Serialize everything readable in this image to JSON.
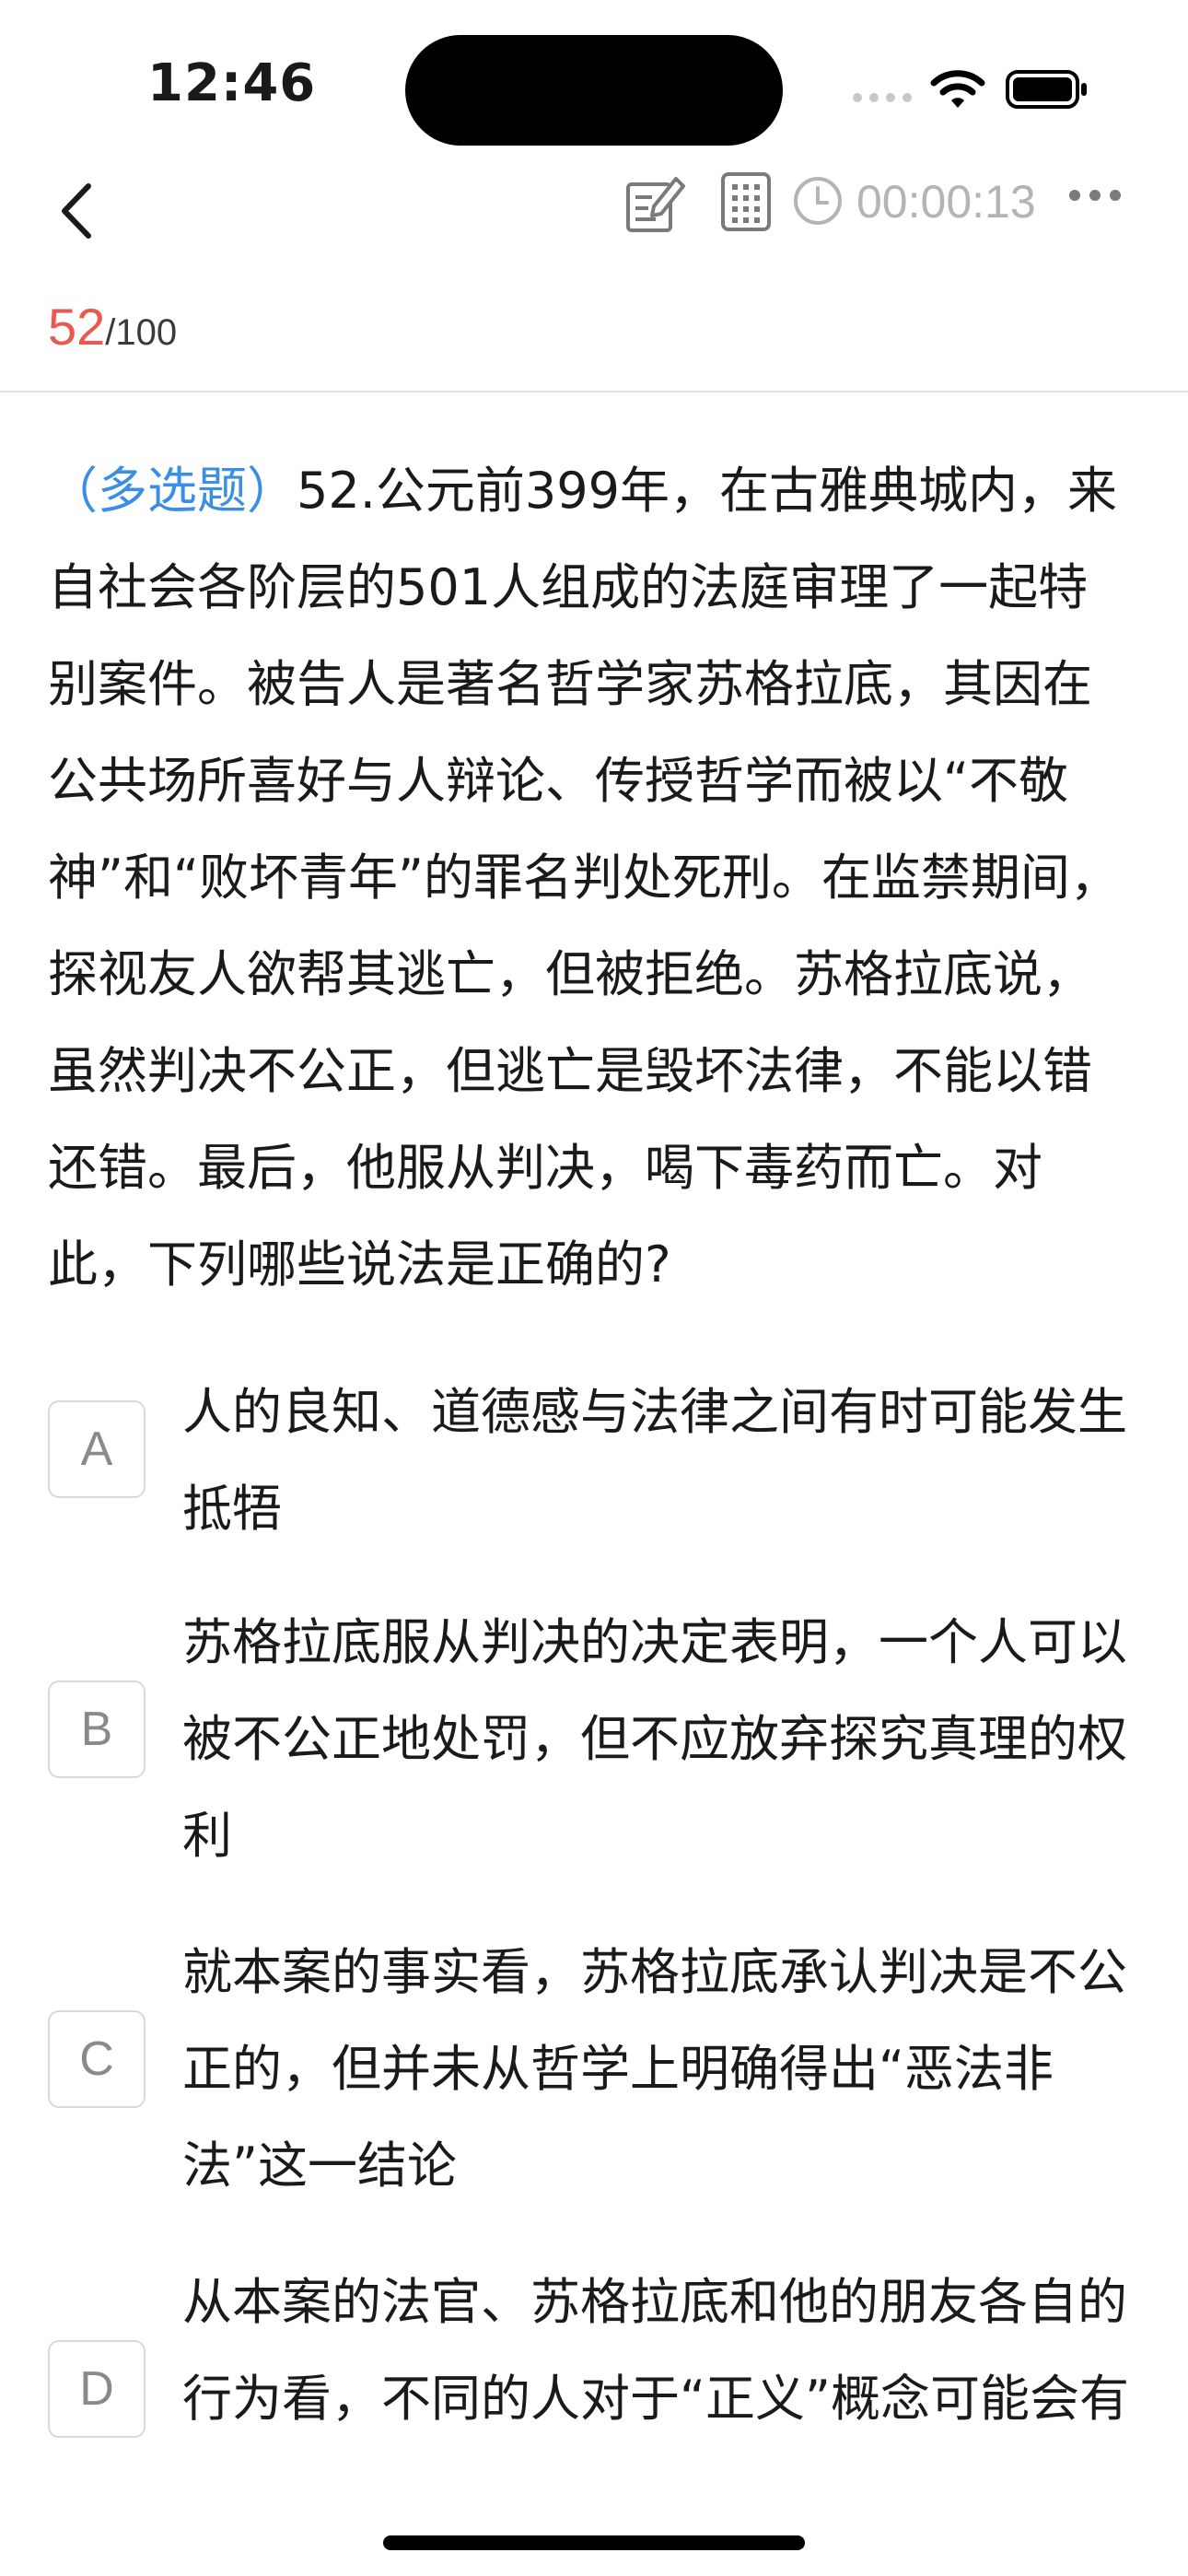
{
  "status_bar": {
    "time": "12:46"
  },
  "nav": {
    "timer": "00:00:13"
  },
  "progress": {
    "current": "52",
    "total": "/100"
  },
  "question": {
    "type_label": "（多选题）",
    "text": "52.公元前399年，在古雅典城内，来自社会各阶层的501人组成的法庭审理了一起特别案件。被告人是著名哲学家苏格拉底，其因在公共场所喜好与人辩论、传授哲学而被以“不敬神”和“败坏青年”的罪名判处死刑。在监禁期间，探视友人欲帮其逃亡，但被拒绝。苏格拉底说，虽然判决不公正，但逃亡是毁坏法律，不能以错还错。最后，他服从判决，喝下毒药而亡。对此，下列哪些说法是正确的?"
  },
  "options": [
    {
      "letter": "A",
      "text": "人的良知、道德感与法律之间有时可能发生抵牾"
    },
    {
      "letter": "B",
      "text": "苏格拉底服从判决的决定表明，一个人可以被不公正地处罚，但不应放弃探究真理的权利"
    },
    {
      "letter": "C",
      "text": "就本案的事实看，苏格拉底承认判决是不公正的，但并未从哲学上明确得出“恶法非法”这一结论"
    },
    {
      "letter": "D",
      "text": "从本案的法官、苏格拉底和他的朋友各自的行为看，不同的人对于“正义”概念可能会有不同的理解"
    }
  ],
  "colors": {
    "accent_blue": "#3a8ee6",
    "progress_red": "#e85a4f",
    "muted_gray": "#b4b4b4"
  },
  "icons": [
    "back-icon",
    "edit-note-icon",
    "answer-sheet-grid-icon",
    "clock-icon",
    "more-icon",
    "signal-icon",
    "wifi-icon",
    "battery-icon"
  ]
}
